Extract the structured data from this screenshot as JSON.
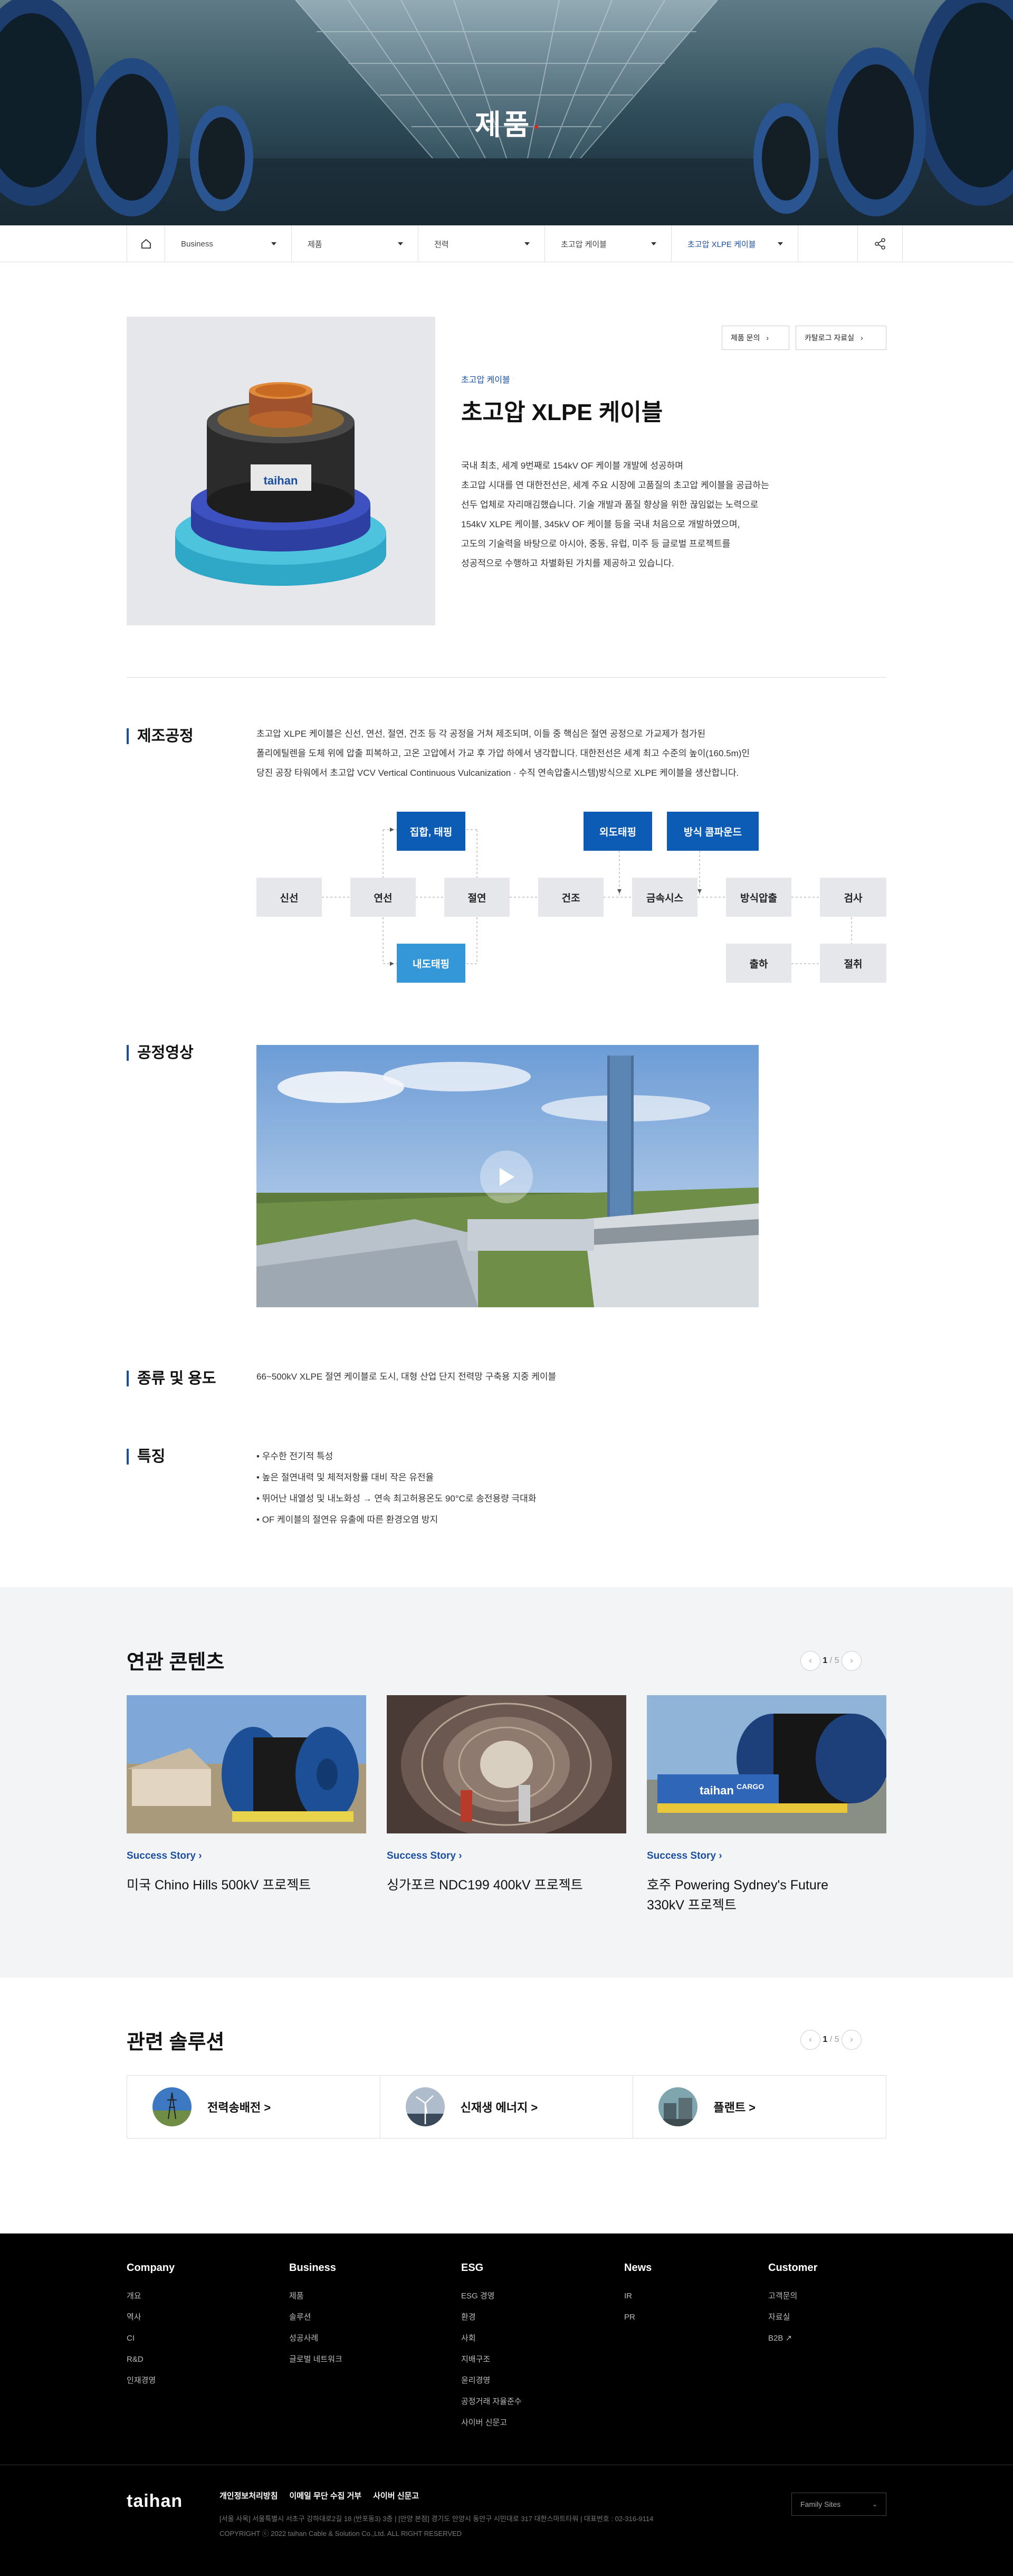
{
  "hero": {
    "title": "제품"
  },
  "nav": {
    "home": "home",
    "items": [
      {
        "label": "Business"
      },
      {
        "label": "제품"
      },
      {
        "label": "전력"
      },
      {
        "label": "초고압 케이블"
      },
      {
        "label": "초고압 XLPE 케이블"
      }
    ]
  },
  "product": {
    "category": "초고압 케이블",
    "title": "초고압 XLPE 케이블",
    "inquiry_button": "제품 문의",
    "catalog_button": "카탈로그 자료실",
    "description": [
      "국내 최초, 세계 9번째로 154kV OF 케이블 개발에 성공하며",
      "초고압 시대를 연 대한전선은, 세계 주요 시장에 고품질의 초고압 케이블을 공급하는",
      "선두 업체로 자리매김했습니다. 기술 개발과 품질 향상을 위한 끊임없는 노력으로",
      "154kV XLPE 케이블, 345kV OF 케이블 등을 국내 처음으로 개발하였으며,",
      "고도의 기술력을 바탕으로 아시아, 중동, 유럽, 미주 등 글로벌 프로젝트를",
      "성공적으로 수행하고 차별화된 가치를 제공하고 있습니다."
    ],
    "image_label": "taihan"
  },
  "process": {
    "title": "제조공정",
    "description": [
      "초고압 XLPE 케이블은 신선, 연선, 절연, 건조 등 각 공정을 거쳐 제조되며, 이들 중 핵심은 절연 공정으로 가교제가 첨가된",
      "폴리에틸렌을 도체 위에 압출 피복하고, 고온 고압에서 가교 후 가압 하에서 냉각합니다. 대한전선은 세계 최고 수준의 높이(160.5m)인",
      "당진 공장 타워에서 초고압 VCV Vertical Continuous Vulcanization · 수직 연속압출시스템)방식으로 XLPE 케이블을 생산합니다."
    ],
    "steps": {
      "s1": "신선",
      "s2": "연선",
      "s3": "절연",
      "s4": "건조",
      "s5": "금속시스",
      "s6": "방식압출",
      "s7": "검사",
      "top1": "집합, 태핑",
      "top2": "외도태핑",
      "top3": "방식 콤파운드",
      "bot1": "내도태핑",
      "bot2": "출하",
      "bot3": "절취"
    }
  },
  "video": {
    "title": "공정영상"
  },
  "usage": {
    "title": "종류 및 용도",
    "text": "66~500kV XLPE 절연 케이블로 도시, 대형 산업 단지 전력망 구축용 지중 케이블"
  },
  "features": {
    "title": "특징",
    "items": [
      "우수한 전기적 특성",
      "높은 절연내력 및 체적저항률 대비 작은 유전율",
      "뛰어난 내열성 및 내노화성 → 연속 최고허용온도 90°C로 송전용량 극대화",
      "OF 케이블의 절연유 유출에 따른 환경오염 방지"
    ]
  },
  "related": {
    "title": "연관 콘텐츠",
    "pager": {
      "current": "1",
      "total": "/ 5"
    },
    "cards": [
      {
        "tag": "Success Story",
        "title": "미국 Chino Hills 500kV 프로젝트"
      },
      {
        "tag": "Success Story",
        "title": "싱가포르 NDC199 400kV 프로젝트"
      },
      {
        "tag": "Success Story",
        "title": "호주 Powering Sydney's Future 330kV 프로젝트"
      }
    ],
    "truck_labels": [
      "taihan",
      "CARGO"
    ]
  },
  "solutions": {
    "title": "관련 솔루션",
    "pager": {
      "current": "1",
      "total": "/ 5"
    },
    "items": [
      {
        "label": "전력송배전 >"
      },
      {
        "label": "신재생 에너지 >"
      },
      {
        "label": "플랜트 >"
      }
    ]
  },
  "footer": {
    "columns": [
      {
        "title": "Company",
        "links": [
          "개요",
          "역사",
          "CI",
          "R&D",
          "인재경영"
        ]
      },
      {
        "title": "Business",
        "links": [
          "제품",
          "솔루션",
          "성공사례",
          "글로벌 네트워크"
        ]
      },
      {
        "title": "ESG",
        "links": [
          "ESG 경영",
          "환경",
          "사회",
          "지배구조",
          "윤리경영",
          "공정거래 자율준수",
          "사이버 신문고"
        ]
      },
      {
        "title": "News",
        "links": [
          "IR",
          "PR"
        ]
      },
      {
        "title": "Customer",
        "links": [
          "고객문의",
          "자료실",
          "B2B"
        ]
      }
    ],
    "logo": "taihan",
    "policy_links": [
      "개인정보처리방침",
      "이메일 무단 수집 거부",
      "사이버 신문고"
    ],
    "address": "[서울 사옥] 서울특별시 서초구 강하대로2길 18 (반포동3) 3층  |  [안양 본점] 경기도 안양시 동안구 시민대로 317 대한스마트타워  |  대표번호 : 02-316-9114",
    "copyright": "COPYRIGHT ⓒ 2022 taihan Cable & Solution Co.,Ltd. ALL RIGHT RESERVED",
    "family_sites": "Family Sites"
  },
  "colors": {
    "accent": "#1a4fa0",
    "process_blue": "#0c5bb5",
    "process_light": "#3498d8",
    "hero_dot": "#e2231a"
  }
}
